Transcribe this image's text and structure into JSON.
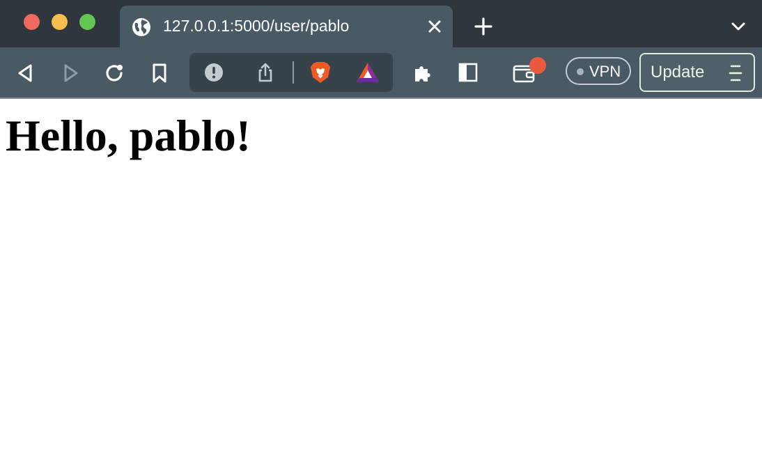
{
  "browser": {
    "tab": {
      "title": "127.0.0.1:5000/user/pablo",
      "icon": "globe-icon"
    },
    "toolbar": {
      "vpn_label": "VPN",
      "update_label": "Update"
    },
    "colors": {
      "titlebar": "#2f363d",
      "toolbar": "#495a64",
      "notification": "#ea5a3e"
    }
  },
  "page": {
    "heading": "Hello, pablo!"
  }
}
